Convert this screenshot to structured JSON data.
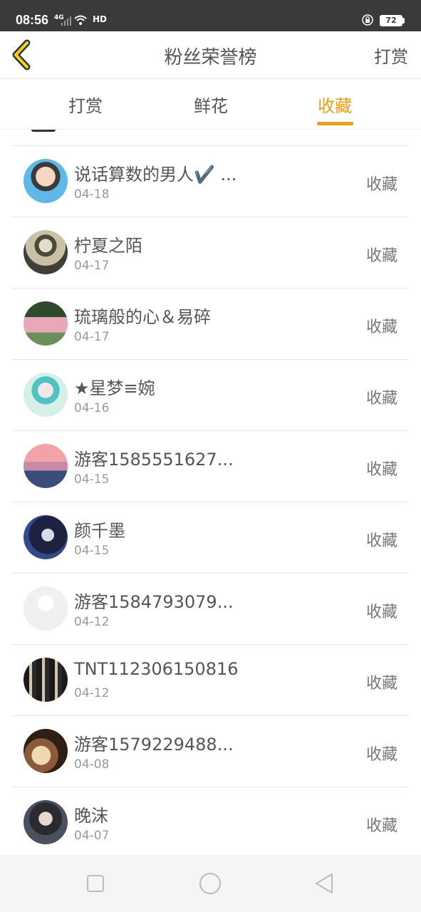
{
  "status_bar": {
    "time": "08:56",
    "network": "4G",
    "hd": "HD",
    "battery": "72"
  },
  "header": {
    "title": "粉丝荣誉榜",
    "right_link": "打赏"
  },
  "tabs": [
    {
      "label": "打赏",
      "active": false
    },
    {
      "label": "鲜花",
      "active": false
    },
    {
      "label": "收藏",
      "active": true
    }
  ],
  "colors": {
    "accent": "#e6a019",
    "text": "#555555",
    "date": "#999999"
  },
  "fans": [
    {
      "name": "说话算数的男人✔️ ...",
      "date": "04-18",
      "action": "收藏"
    },
    {
      "name": "柠夏之陌",
      "date": "04-17",
      "action": "收藏"
    },
    {
      "name": "琉璃般的心＆易碎",
      "date": "04-17",
      "action": "收藏"
    },
    {
      "name": "★星梦≡婉",
      "date": "04-16",
      "action": "收藏"
    },
    {
      "name": "游客1585551627...",
      "date": "04-15",
      "action": "收藏"
    },
    {
      "name": "颜千墨",
      "date": "04-15",
      "action": "收藏"
    },
    {
      "name": "游客1584793079...",
      "date": "04-12",
      "action": "收藏"
    },
    {
      "name": "TNT112306150816",
      "date": "04-12",
      "action": "收藏"
    },
    {
      "name": "游客1579229488...",
      "date": "04-08",
      "action": "收藏"
    },
    {
      "name": "晚沫",
      "date": "04-07",
      "action": "收藏"
    }
  ]
}
